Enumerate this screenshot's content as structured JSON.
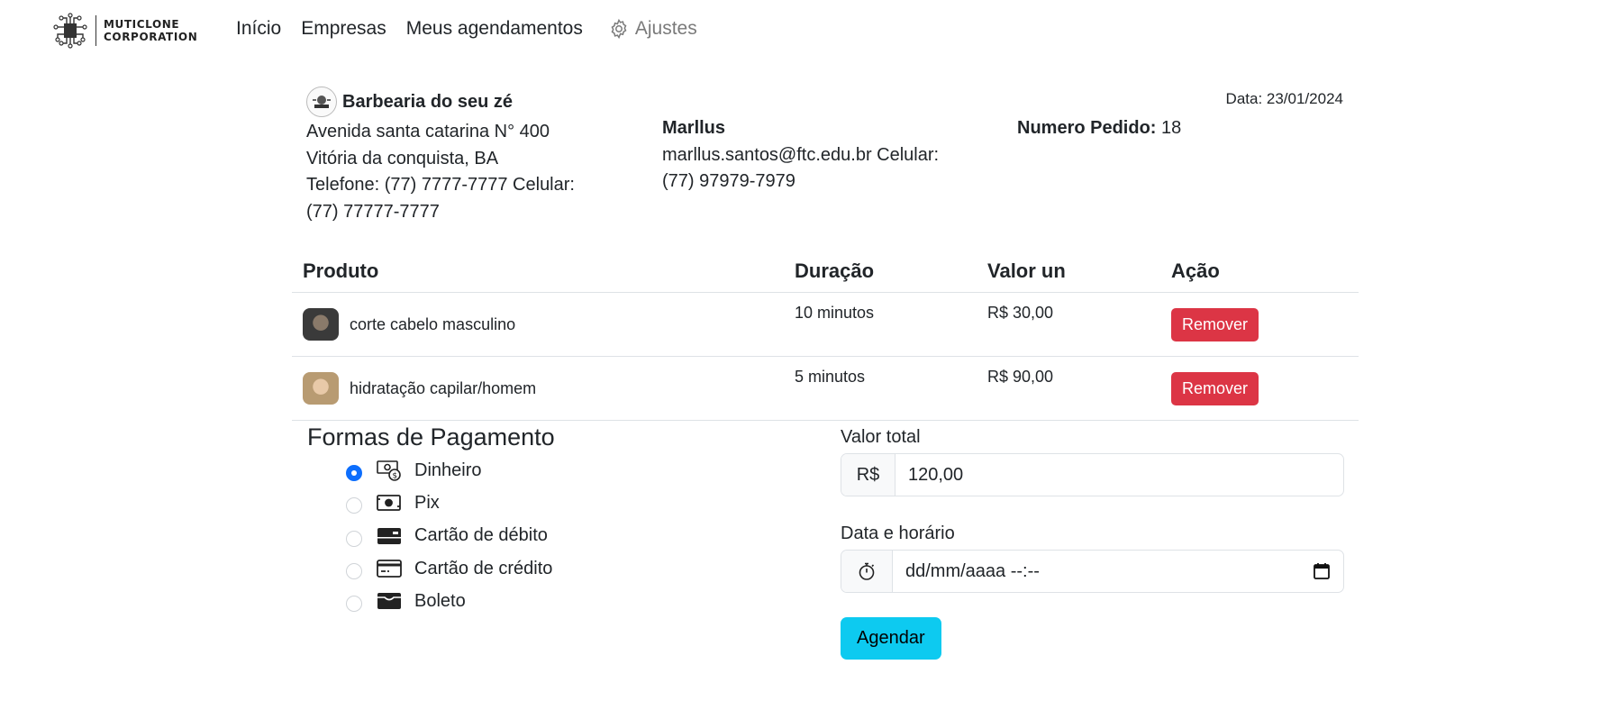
{
  "brand": {
    "line1": "MUTICLONE",
    "line2": "CORPORATION"
  },
  "nav": {
    "home": "Início",
    "companies": "Empresas",
    "appointments": "Meus agendamentos",
    "settings": "Ajustes"
  },
  "company": {
    "name": "Barbearia do seu zé",
    "address": "Avenida santa catarina N° 400",
    "city": "Vitória da conquista, BA",
    "phone_line": "Telefone: (77) 7777-7777 Celular:",
    "mobile": "(77) 77777-7777"
  },
  "client": {
    "name": "Marllus",
    "email_line": "marllus.santos@ftc.edu.br Celular:",
    "mobile": "(77) 97979-7979"
  },
  "order": {
    "label": "Numero Pedido:",
    "number": "18",
    "date": "Data: 23/01/2024"
  },
  "table": {
    "headers": [
      "Produto",
      "Duração",
      "Valor un",
      "Ação"
    ],
    "rows": [
      {
        "product": "corte cabelo masculino",
        "duration": "10 minutos",
        "price": "R$ 30,00",
        "action": "Remover"
      },
      {
        "product": "hidratação capilar/homem",
        "duration": "5 minutos",
        "price": "R$ 90,00",
        "action": "Remover"
      }
    ]
  },
  "payment": {
    "title": "Formas de Pagamento",
    "options": [
      {
        "label": "Dinheiro",
        "icon": "cash-coin-icon",
        "checked": true
      },
      {
        "label": "Pix",
        "icon": "cash-icon",
        "checked": false
      },
      {
        "label": "Cartão de débito",
        "icon": "debit-card-icon",
        "checked": false
      },
      {
        "label": "Cartão de crédito",
        "icon": "credit-card-icon",
        "checked": false
      },
      {
        "label": "Boleto",
        "icon": "wallet-icon",
        "checked": false
      }
    ]
  },
  "total": {
    "label": "Valor total",
    "currency": "R$",
    "value": "120,00"
  },
  "datetime": {
    "label": "Data e horário",
    "placeholder": "dd/mm/aaaa --:--"
  },
  "submit": {
    "label": "Agendar"
  },
  "colors": {
    "primary": "#0d6efd",
    "danger": "#dc3545",
    "info": "#0dcaf0"
  }
}
